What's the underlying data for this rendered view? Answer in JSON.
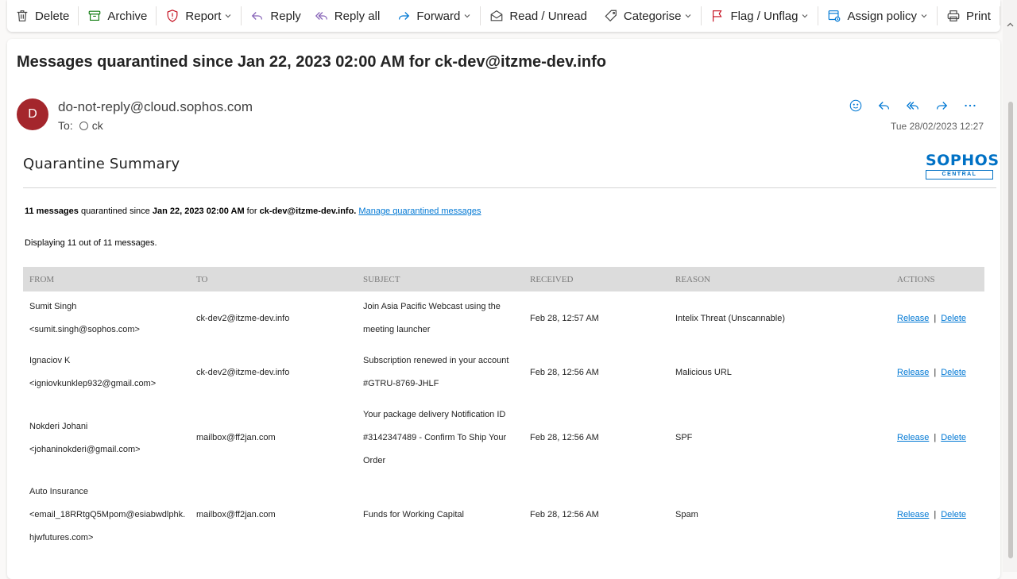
{
  "toolbar": {
    "delete": "Delete",
    "archive": "Archive",
    "report": "Report",
    "reply": "Reply",
    "reply_all": "Reply all",
    "forward": "Forward",
    "read_unread": "Read / Unread",
    "categorise": "Categorise",
    "flag_unflag": "Flag / Unflag",
    "assign_policy": "Assign policy",
    "print": "Print"
  },
  "message": {
    "subject": "Messages quarantined since Jan 22, 2023 02:00 AM for ck-dev@itzme-dev.info",
    "avatar_initial": "D",
    "sender": "do-not-reply@cloud.sophos.com",
    "to_label": "To:",
    "to_name": "ck",
    "date": "Tue 28/02/2023 12:27"
  },
  "email_body": {
    "title": "Quarantine Summary",
    "logo_main": "SOPHOS",
    "logo_sub": "CENTRAL",
    "summary_count": "11 messages",
    "summary_text1": " quarantined since ",
    "summary_date": "Jan 22, 2023 02:00 AM",
    "summary_text2": " for ",
    "summary_recipient": "ck-dev@itzme-dev.info.",
    "summary_link": "Manage quarantined messages",
    "displaying": "Displaying 11 out of 11 messages.",
    "columns": [
      "FROM",
      "TO",
      "SUBJECT",
      "RECEIVED",
      "REASON",
      "ACTIONS"
    ],
    "rows": [
      {
        "from_name": "Sumit Singh",
        "from_email": "<sumit.singh@sophos.com>",
        "to": "ck-dev2@itzme-dev.info",
        "subject": "Join Asia Pacific Webcast using the meeting launcher",
        "received": "Feb 28, 12:57 AM",
        "reason": "Intelix Threat (Unscannable)"
      },
      {
        "from_name": "Ignaciov K",
        "from_email": "<igniovkunklep932@gmail.com>",
        "to": "ck-dev2@itzme-dev.info",
        "subject": "Subscription renewed in your account #GTRU-8769-JHLF",
        "received": "Feb 28, 12:56 AM",
        "reason": "Malicious URL"
      },
      {
        "from_name": "Nokderi Johani",
        "from_email": "<johaninokderi@gmail.com>",
        "to": "mailbox@ff2jan.com",
        "subject": "Your package delivery Notification ID #3142347489 - Confirm To Ship Your Order",
        "received": "Feb 28, 12:56 AM",
        "reason": "SPF"
      },
      {
        "from_name": "Auto Insurance",
        "from_email": "<email_18RRtgQ5Mpom@esiabwdlphk.hjwfutures.com>",
        "to": "mailbox@ff2jan.com",
        "subject": "Funds for Working Capital",
        "received": "Feb 28, 12:56 AM",
        "reason": "Spam"
      }
    ],
    "release_label": "Release",
    "action_separator": "|",
    "delete_label": "Delete"
  }
}
